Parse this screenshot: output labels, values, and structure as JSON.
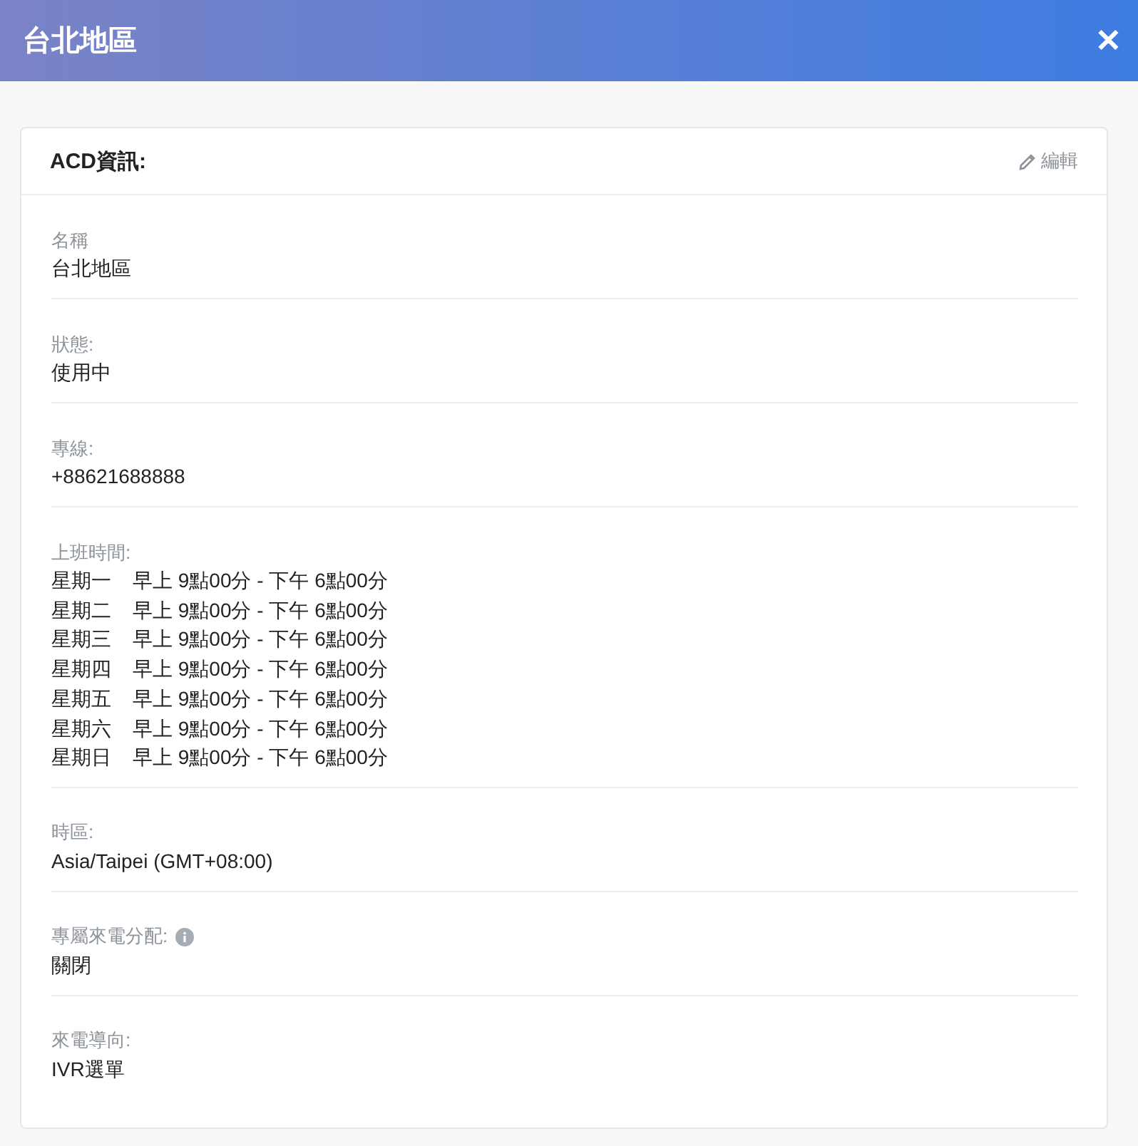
{
  "window": {
    "title": "台北地區",
    "close": "✕"
  },
  "card": {
    "title": "ACD資訊:",
    "edit_label": "編輯",
    "fields": [
      {
        "kind": "text",
        "label": "名稱",
        "value": "台北地區",
        "info": false
      },
      {
        "kind": "text",
        "label": "狀態:",
        "value": "使用中",
        "info": false
      },
      {
        "kind": "text",
        "label": "專線:",
        "value": "+88621688888",
        "info": false
      },
      {
        "kind": "schedule",
        "label": "上班時間:",
        "info": false,
        "rows": [
          {
            "day": "星期一",
            "hours": "早上 9點00分 - 下午 6點00分"
          },
          {
            "day": "星期二",
            "hours": "早上 9點00分 - 下午 6點00分"
          },
          {
            "day": "星期三",
            "hours": "早上 9點00分 - 下午 6點00分"
          },
          {
            "day": "星期四",
            "hours": "早上 9點00分 - 下午 6點00分"
          },
          {
            "day": "星期五",
            "hours": "早上 9點00分 - 下午 6點00分"
          },
          {
            "day": "星期六",
            "hours": "早上 9點00分 - 下午 6點00分"
          },
          {
            "day": "星期日",
            "hours": "早上 9點00分 - 下午 6點00分"
          }
        ]
      },
      {
        "kind": "text",
        "label": "時區:",
        "value": "Asia/Taipei (GMT+08:00)",
        "info": false
      },
      {
        "kind": "text",
        "label": "專屬來電分配:",
        "value": "關閉",
        "info": true
      },
      {
        "kind": "text",
        "label": "來電導向:",
        "value": "IVR選單",
        "info": false
      }
    ]
  }
}
